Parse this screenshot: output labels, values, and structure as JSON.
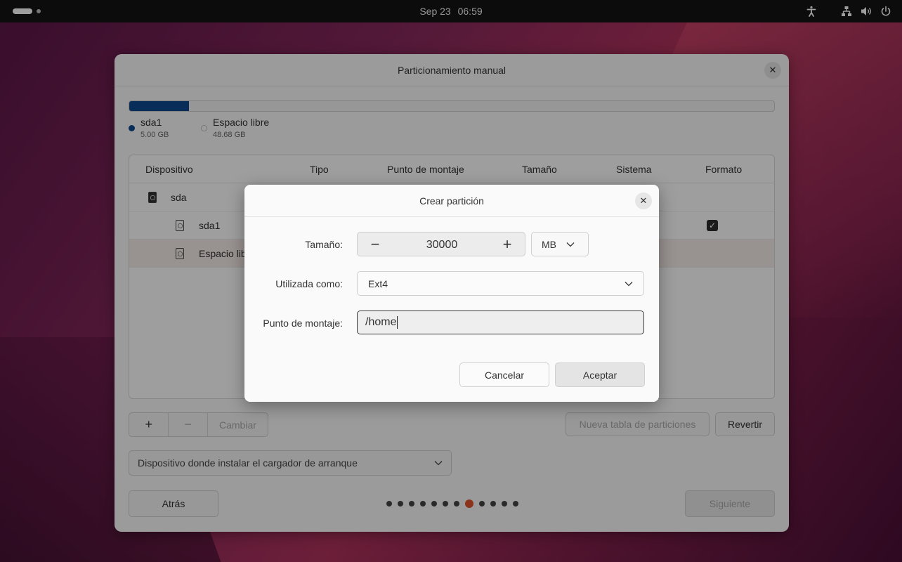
{
  "topbar": {
    "date": "Sep 23",
    "time": "06:59",
    "icons": [
      "accessibility-icon",
      "network-icon",
      "volume-icon",
      "power-icon"
    ]
  },
  "window": {
    "title": "Particionamiento manual",
    "usage": {
      "used_fraction": 0.093,
      "legend": [
        {
          "name": "sda1",
          "size": "5.00 GB",
          "color": "#0e4a8f"
        },
        {
          "name": "Espacio libre",
          "size": "48.68 GB",
          "color": "#ffffff"
        }
      ]
    },
    "table": {
      "headers": [
        "Dispositivo",
        "Tipo",
        "Punto de montaje",
        "Tamaño",
        "Sistema",
        "Formato"
      ],
      "rows": [
        {
          "device": "sda"
        },
        {
          "device": "sda1",
          "format_checked": true
        },
        {
          "device": "Espacio libre"
        }
      ]
    },
    "buttons": {
      "add": "+",
      "remove": "−",
      "change": "Cambiar",
      "new_table": "Nueva tabla de particiones",
      "revert": "Revertir",
      "back": "Atrás",
      "next": "Siguiente"
    },
    "bootloader_label": "Dispositivo donde instalar el cargador de arranque",
    "pager": {
      "total": 12,
      "active": 7
    }
  },
  "dialog": {
    "title": "Crear partición",
    "size_label": "Tamaño:",
    "size_value": "30000",
    "unit": "MB",
    "used_as_label": "Utilizada como:",
    "used_as_value": "Ext4",
    "mount_label": "Punto de montaje:",
    "mount_value": "/home",
    "cancel": "Cancelar",
    "accept": "Aceptar"
  }
}
